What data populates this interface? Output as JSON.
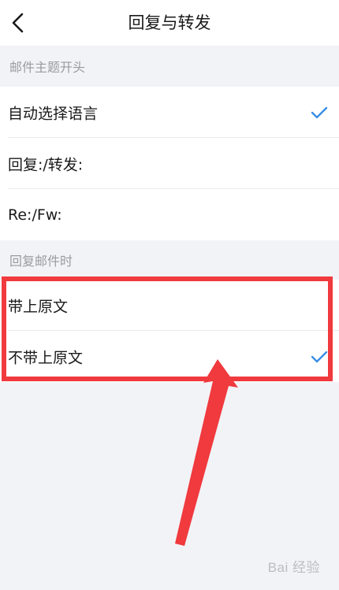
{
  "header": {
    "back_icon": "chevron-left-icon",
    "title": "回复与转发"
  },
  "sections": [
    {
      "label": "邮件主题开头",
      "items": [
        {
          "label": "自动选择语言",
          "checked": true
        },
        {
          "label": "回复:/转发:",
          "checked": false
        },
        {
          "label": "Re:/Fw:",
          "checked": false
        }
      ]
    },
    {
      "label": "回复邮件时",
      "items": [
        {
          "label": "带上原文",
          "checked": false
        },
        {
          "label": "不带上原文",
          "checked": true
        }
      ]
    }
  ],
  "colors": {
    "check": "#3a8ee6",
    "annotation": "#f03a3e",
    "background": "#f2f3f7"
  },
  "watermark": "Bai 经验"
}
